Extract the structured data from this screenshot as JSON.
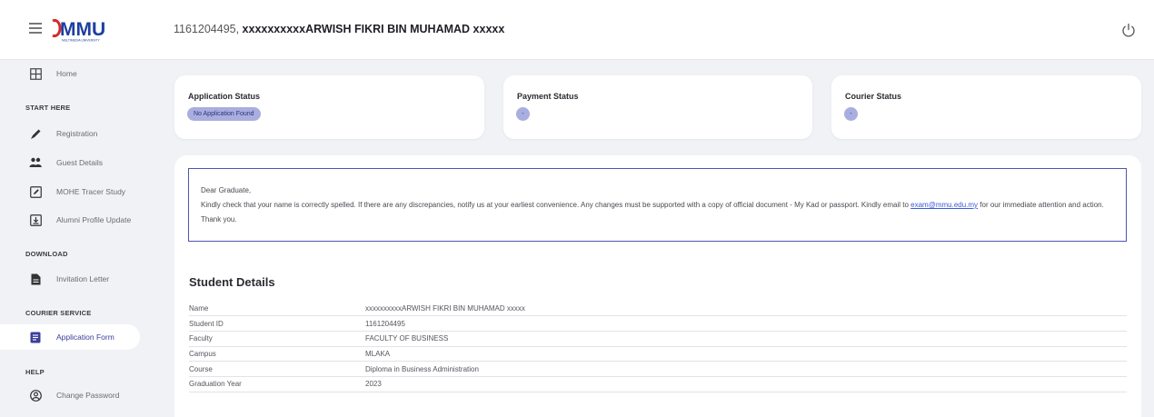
{
  "header": {
    "student_id_prefix": "1161204495, ",
    "student_name": "xxxxxxxxxxARWISH FIKRI BIN MUHAMAD xxxxx",
    "logo_text": "MMU",
    "logo_subtext": "MULTIMEDIA UNIVERSITY"
  },
  "sidebar": {
    "home": "Home",
    "start_here": "START HERE",
    "registration": "Registration",
    "guest_details": "Guest Details",
    "tracer_study": "MOHE Tracer Study",
    "alumni_update": "Alumni Profile Update",
    "download": "DOWNLOAD",
    "invitation_letter": "Invitation Letter",
    "courier_service": "COURIER SERVICE",
    "application_form": "Application Form",
    "help": "HELP",
    "change_password": "Change Password"
  },
  "status": {
    "application_title": "Application Status",
    "application_value": "No Application Found",
    "payment_title": "Payment Status",
    "payment_value": "-",
    "courier_title": "Courier Status",
    "courier_value": "-"
  },
  "notice": {
    "greeting": "Dear Graduate,",
    "body": "Kindly check that your name is correctly spelled. If there are any discrepancies, notify us at your earliest convenience. Any changes must be supported with a copy of official document - My Kad or passport. Kindly email to ",
    "email": "exam@mmu.edu.my",
    "closing": " for our immediate attention and action. Thank you."
  },
  "student_details": {
    "title": "Student Details",
    "rows": [
      {
        "label": "Name",
        "value": "xxxxxxxxxxARWISH FIKRI BIN MUHAMAD xxxxx"
      },
      {
        "label": "Student ID",
        "value": "1161204495"
      },
      {
        "label": "Faculty",
        "value": "FACULTY OF BUSINESS"
      },
      {
        "label": "Campus",
        "value": "MLAKA"
      },
      {
        "label": "Course",
        "value": "Diploma in Business Administration"
      },
      {
        "label": "Graduation Year",
        "value": "2023"
      }
    ]
  },
  "colors": {
    "accent": "#3b3e9b",
    "badge_bg": "#a9aee0",
    "notice_border": "#4d55b0",
    "logo_blue": "#1d3fa0"
  }
}
